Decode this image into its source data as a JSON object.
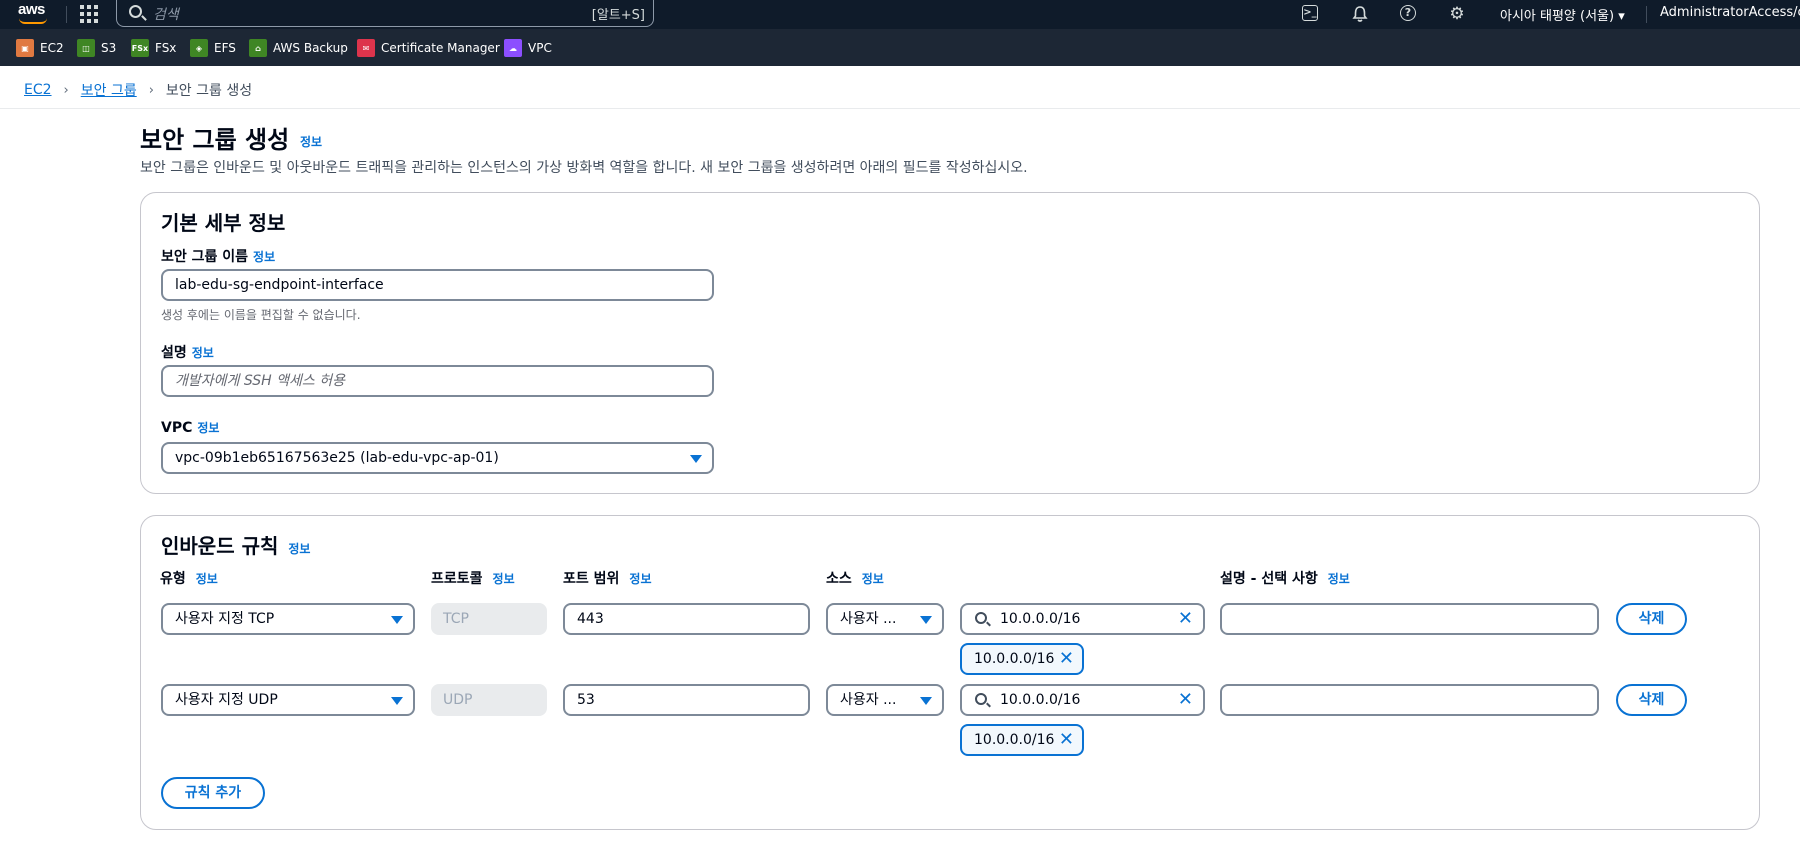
{
  "topnav": {
    "logo_text": "aws",
    "search_placeholder": "검색",
    "search_shortcut": "[알트+S]",
    "region": "아시아 태평양 (서울) ▾",
    "account": "AdministratorAccess/clou"
  },
  "services": [
    {
      "label": "EC2",
      "icon": "ec2-icon",
      "color": "#e07941"
    },
    {
      "label": "S3",
      "icon": "s3-icon",
      "color": "#3f8624"
    },
    {
      "label": "FSx",
      "icon": "fsx-icon",
      "color": "#3f8624",
      "icon_text": "FSx"
    },
    {
      "label": "EFS",
      "icon": "efs-icon",
      "color": "#3f8624"
    },
    {
      "label": "AWS Backup",
      "icon": "backup-icon",
      "color": "#3f8624"
    },
    {
      "label": "Certificate Manager",
      "icon": "certificate-icon",
      "color": "#dd344c"
    },
    {
      "label": "VPC",
      "icon": "vpc-icon",
      "color": "#8c4fff"
    }
  ],
  "breadcrumb": {
    "items": [
      "EC2",
      "보안 그룹"
    ],
    "current": "보안 그룹 생성"
  },
  "header": {
    "title": "보안 그룹 생성",
    "info": "정보",
    "description": "보안 그룹은 인바운드 및 아웃바운드 트래픽을 관리하는 인스턴스의 가상 방화벽 역할을 합니다. 새 보안 그룹을 생성하려면 아래의 필드를 작성하십시오."
  },
  "basic": {
    "title": "기본 세부 정보",
    "name_label": "보안 그룹 이름",
    "name_value": "lab-edu-sg-endpoint-interface",
    "name_hint": "생성 후에는 이름을 편집할 수 없습니다.",
    "desc_label": "설명",
    "desc_placeholder": "개발자에게 SSH 액세스 허용",
    "vpc_label": "VPC",
    "vpc_value": "vpc-09b1eb65167563e25 (lab-edu-vpc-ap-01)",
    "info": "정보"
  },
  "inbound": {
    "title": "인바운드 규칙",
    "info": "정보",
    "columns": {
      "type": "유형",
      "protocol": "프로토콜",
      "port": "포트 범위",
      "source": "소스",
      "description": "설명 - 선택 사항"
    },
    "rules": [
      {
        "type": "사용자 지정 TCP",
        "protocol": "TCP",
        "port": "443",
        "source_type": "사용자 ...",
        "source_search": "10.0.0.0/16",
        "token": "10.0.0.0/16",
        "description": "",
        "delete": "삭제"
      },
      {
        "type": "사용자 지정 UDP",
        "protocol": "UDP",
        "port": "53",
        "source_type": "사용자 ...",
        "source_search": "10.0.0.0/16",
        "token": "10.0.0.0/16",
        "description": "",
        "delete": "삭제"
      }
    ],
    "add_rule": "규칙 추가"
  }
}
